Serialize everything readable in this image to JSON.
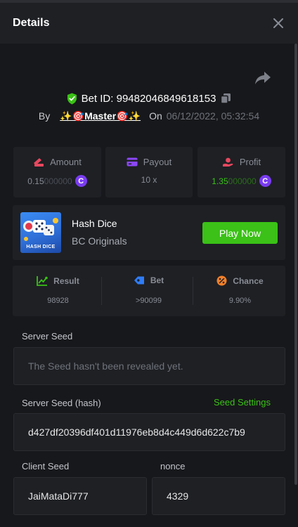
{
  "header": {
    "title": "Details"
  },
  "bet": {
    "id_text": "Bet ID: 99482046849618153",
    "by_label": "By",
    "user_name": "✨🎯Master🎯✨",
    "on_label": "On",
    "date": "06/12/2022, 05:32:54"
  },
  "stats": {
    "amount": {
      "label": "Amount",
      "value_main": "0.15",
      "value_faded": "000000"
    },
    "payout": {
      "label": "Payout",
      "value": "10 x"
    },
    "profit": {
      "label": "Profit",
      "value_main": "1.35",
      "value_faded": "000000"
    },
    "coin_symbol": "C"
  },
  "game": {
    "name": "Hash Dice",
    "provider": "BC Originals",
    "thumb_label": "HASH DICE",
    "play_label": "Play Now"
  },
  "dice": {
    "result": {
      "label": "Result",
      "value": "98928"
    },
    "bet": {
      "label": "Bet",
      "value": ">90099"
    },
    "chance": {
      "label": "Chance",
      "value": "9.90%"
    }
  },
  "seeds": {
    "server_seed_label": "Server Seed",
    "server_seed_value": "The Seed hasn't been revealed yet.",
    "server_hash_label": "Server Seed (hash)",
    "seed_settings_label": "Seed Settings",
    "server_hash_value": "d427df20396df401d11976eb8d4c449d6d622c7b9",
    "client_seed_label": "Client Seed",
    "client_seed_value": "JaiMataDi777",
    "nonce_label": "nonce",
    "nonce_value": "4329"
  },
  "colors": {
    "accent_green": "#3bc117",
    "coin_purple": "#7a3cf0",
    "background": "#17181b",
    "panel": "#1e2024"
  }
}
